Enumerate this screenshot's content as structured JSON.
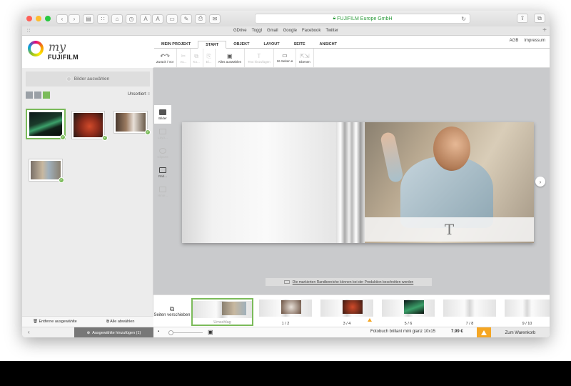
{
  "browser": {
    "url": "FUJIFILM Europe GmbH",
    "bookmarks": [
      "GDrive",
      "Toggl",
      "Gmail",
      "Google",
      "Facebook",
      "Twitter"
    ],
    "font_buttons": [
      "A",
      "A"
    ]
  },
  "logo": {
    "script": "my",
    "brand": "FUJIFILM"
  },
  "header": {
    "links": [
      "AGB",
      "Impressum"
    ],
    "tabs": [
      "MEIN PROJEKT",
      "START",
      "OBJEKT",
      "LAYOUT",
      "SEITE",
      "ANSICHT"
    ],
    "active_tab": "START"
  },
  "ribbon": {
    "undo_redo": "Zurück / Vor",
    "cut": "Au...",
    "copy": "Ko...",
    "paste": "Ei...",
    "select_all": "Alles auswählen",
    "add_text": "Text hinzufügen",
    "pages": "16 Seiten ▾",
    "layers": "Ebenen"
  },
  "left_panel": {
    "select_images": "Bilder auswählen",
    "sort": "Unsortiert",
    "remove_selected": "Entferne ausgewählte",
    "deselect_all": "Alle abwählen",
    "add_selected": "Ausgewählte hinzufügen (1)"
  },
  "vtools": [
    "Bilder",
    "Layo...",
    "Cliparts",
    "Rah...",
    "Hinte..."
  ],
  "canvas": {
    "text_placeholder": "T",
    "notice": "Die markierten Randbereiche können bei der Produktion beschnitten werden"
  },
  "strip": {
    "move_pages": "Seiten verschieben",
    "pages": [
      {
        "label": "Umschlag"
      },
      {
        "label": "1 / 2"
      },
      {
        "label": "3 / 4"
      },
      {
        "label": "5 / 6"
      },
      {
        "label": "7 / 8"
      },
      {
        "label": "9 / 10"
      }
    ]
  },
  "status": {
    "product": "Fotobuch brillant mini glanz 10x15",
    "price": "7.99 €",
    "cart": "Zum Warenkorb"
  },
  "colors": {
    "accent_green": "#7bbb5a",
    "warning": "#f5a623",
    "url_green": "#2a9a3a"
  }
}
